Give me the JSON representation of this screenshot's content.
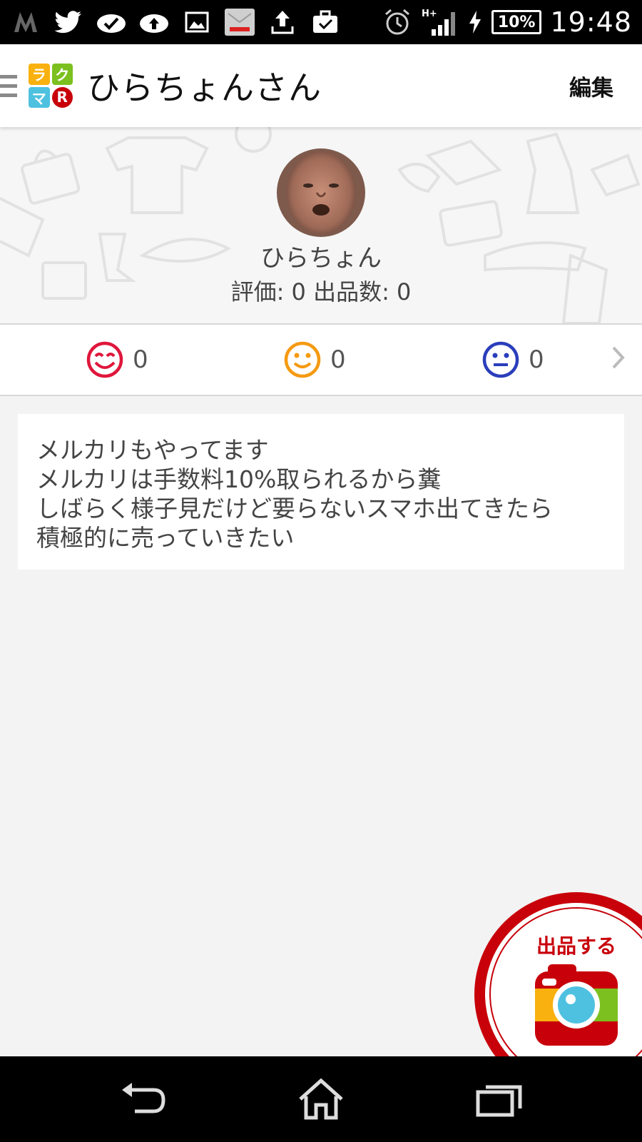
{
  "status_bar": {
    "time": "19:48",
    "battery": "10%",
    "network": "H+",
    "left_icons": [
      "m-logo-icon",
      "twitter-icon",
      "check-cloud-icon",
      "upload-cloud-icon",
      "image-icon",
      "yahoo-mail-icon",
      "upload-icon",
      "briefcase-check-icon"
    ],
    "right_icons": [
      "alarm-icon",
      "signal-icon",
      "charging-icon"
    ]
  },
  "app_bar": {
    "logo_letters": [
      "ラ",
      "ク",
      "マ",
      "R"
    ],
    "title": "ひらちょんさん",
    "edit_label": "編集"
  },
  "profile": {
    "username": "ひらちょん",
    "stats_text": "評価: 0 出品数: 0"
  },
  "ratings": [
    {
      "name": "good",
      "icon": "smile-good-icon",
      "color": "#e0163c",
      "count": "0"
    },
    {
      "name": "normal",
      "icon": "smile-normal-icon",
      "color": "#f59a11",
      "count": "0"
    },
    {
      "name": "bad",
      "icon": "smile-bad-icon",
      "color": "#2a3ebb",
      "count": "0"
    }
  ],
  "bio": {
    "lines": [
      "メルカリもやってます",
      "メルカリは手数料10%取られるから糞",
      "しばらく様子見だけど要らないスマホ出てきたら",
      "積極的に売っていきたい"
    ]
  },
  "fab": {
    "label": "出品する",
    "icon": "camera-icon"
  },
  "nav_bar": {
    "icons": [
      "back-icon",
      "home-icon",
      "recent-apps-icon"
    ]
  },
  "colors": {
    "accent_red": "#c8000a",
    "logo_yellow": "#f9b10f",
    "logo_green": "#7cc020",
    "logo_blue": "#4ec1e0",
    "logo_red": "#c8000a"
  }
}
